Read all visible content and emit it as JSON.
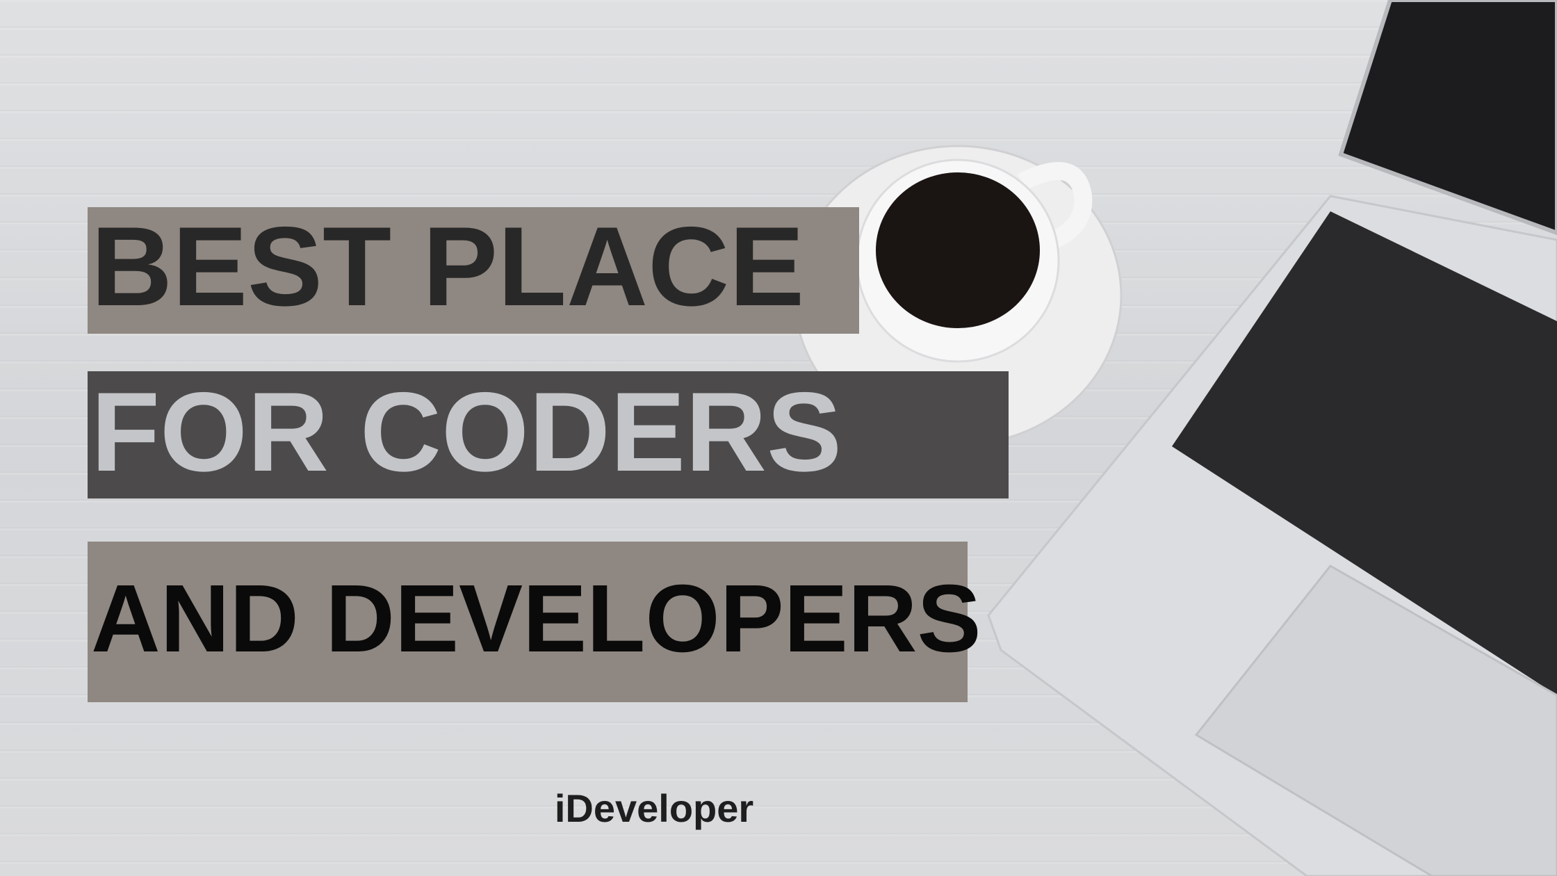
{
  "headline": {
    "line1": "BEST PLACE",
    "line2": "FOR CODERS",
    "line3": "AND DEVELOPERS"
  },
  "brand": "iDeveloper",
  "colors": {
    "taupe_box": "#8f8781",
    "dark_box": "#4c4a4b",
    "light_text": "#c4c5c9",
    "dark_text": "#282828"
  }
}
